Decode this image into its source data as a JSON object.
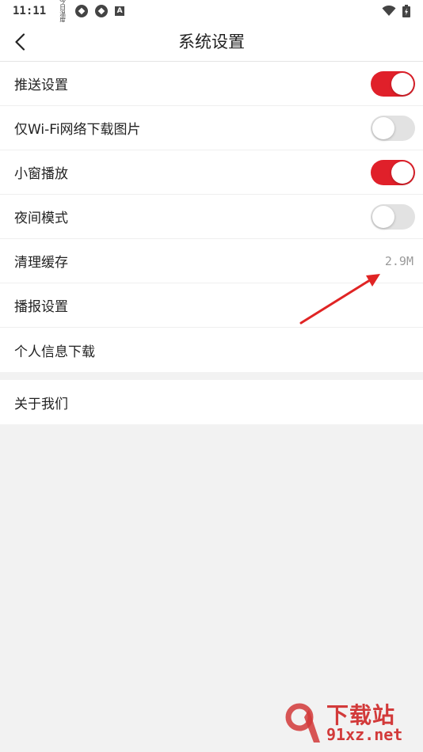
{
  "status_bar": {
    "time": "11:11",
    "notification_icons": [
      "weather-icon",
      "app-icon",
      "app-icon",
      "a-icon"
    ],
    "weather_glyph": "今日\n温度",
    "a_label": "A"
  },
  "header": {
    "title": "系统设置"
  },
  "settings": [
    {
      "label": "推送设置",
      "toggle": true
    },
    {
      "label": "仅Wi-Fi网络下载图片",
      "toggle": false
    },
    {
      "label": "小窗播放",
      "toggle": true
    },
    {
      "label": "夜间模式",
      "toggle": false
    },
    {
      "label": "清理缓存",
      "value": "2.9M"
    },
    {
      "label": "播报设置"
    },
    {
      "label": "个人信息下载"
    }
  ],
  "settings_group2": [
    {
      "label": "关于我们"
    }
  ],
  "watermark": {
    "title": "下载站",
    "domain": "91xz.net"
  },
  "colors": {
    "accent": "#e0202a",
    "background": "#f2f2f2",
    "annotation_arrow": "#e02424"
  }
}
